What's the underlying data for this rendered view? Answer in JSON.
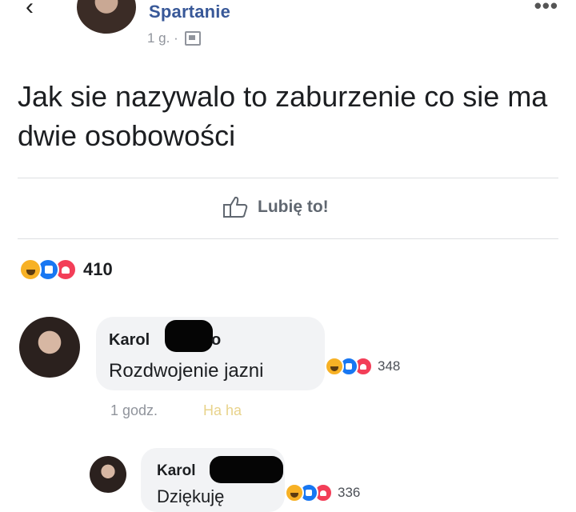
{
  "header": {
    "author_name": "Spartanie",
    "post_time": "1 g. ·",
    "more_icon": "more-dots-icon",
    "back_icon": "back-arrow-icon",
    "privacy_icon": "group-icon"
  },
  "post": {
    "text": "Jak sie nazywalo to zaburzenie co sie ma dwie osobowości",
    "like_label": "Lubię to!",
    "like_icon": "thumbs-up-icon"
  },
  "reactions": {
    "icons": [
      "haha-icon",
      "like-icon",
      "love-icon"
    ],
    "count": "410"
  },
  "comments": [
    {
      "name": "Karol",
      "name_tail": "o",
      "text": "Rozdwojenie jazni",
      "reaction_count": "348",
      "time": "1 godz.",
      "action_label": "Ha ha"
    },
    {
      "name": "Karol",
      "text": "Dziękuję",
      "reaction_count": "336"
    }
  ],
  "colors": {
    "link_blue": "#385898",
    "haha_yellow": "#f7b125",
    "like_blue": "#1877f2",
    "love_red": "#f33e58",
    "bubble_bg": "#f2f3f5"
  }
}
